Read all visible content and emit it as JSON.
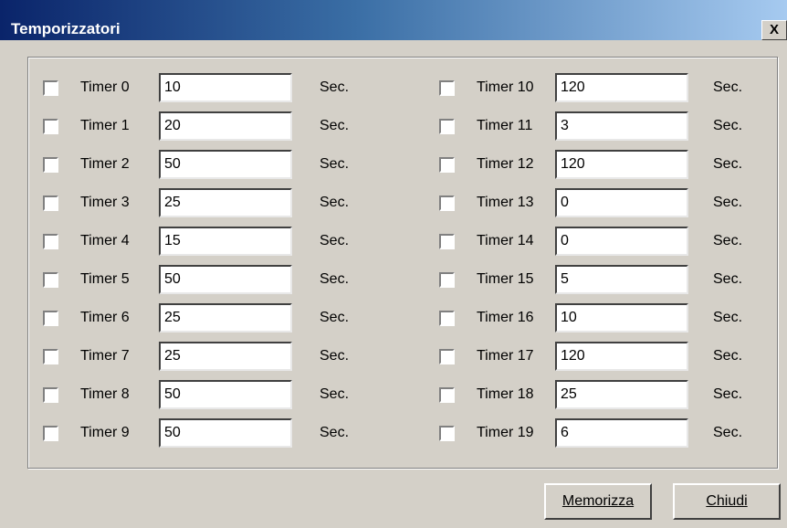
{
  "window": {
    "title": "Temporizzatori",
    "close_label": "X"
  },
  "unit": "Sec.",
  "timers": [
    {
      "label": "Timer 0",
      "value": "10"
    },
    {
      "label": "Timer 1",
      "value": "20"
    },
    {
      "label": "Timer 2",
      "value": "50"
    },
    {
      "label": "Timer 3",
      "value": "25"
    },
    {
      "label": "Timer 4",
      "value": "15"
    },
    {
      "label": "Timer 5",
      "value": "50"
    },
    {
      "label": "Timer 6",
      "value": "25"
    },
    {
      "label": "Timer 7",
      "value": "25"
    },
    {
      "label": "Timer 8",
      "value": "50"
    },
    {
      "label": "Timer 9",
      "value": "50"
    },
    {
      "label": "Timer 10",
      "value": "120"
    },
    {
      "label": "Timer 11",
      "value": "3"
    },
    {
      "label": "Timer 12",
      "value": "120"
    },
    {
      "label": "Timer 13",
      "value": "0"
    },
    {
      "label": "Timer 14",
      "value": "0"
    },
    {
      "label": "Timer 15",
      "value": "5"
    },
    {
      "label": "Timer 16",
      "value": "10"
    },
    {
      "label": "Timer 17",
      "value": "120"
    },
    {
      "label": "Timer 18",
      "value": "25"
    },
    {
      "label": "Timer 19",
      "value": "6"
    }
  ],
  "buttons": {
    "save_label": "Memorizza",
    "close_label": "Chiudi"
  }
}
